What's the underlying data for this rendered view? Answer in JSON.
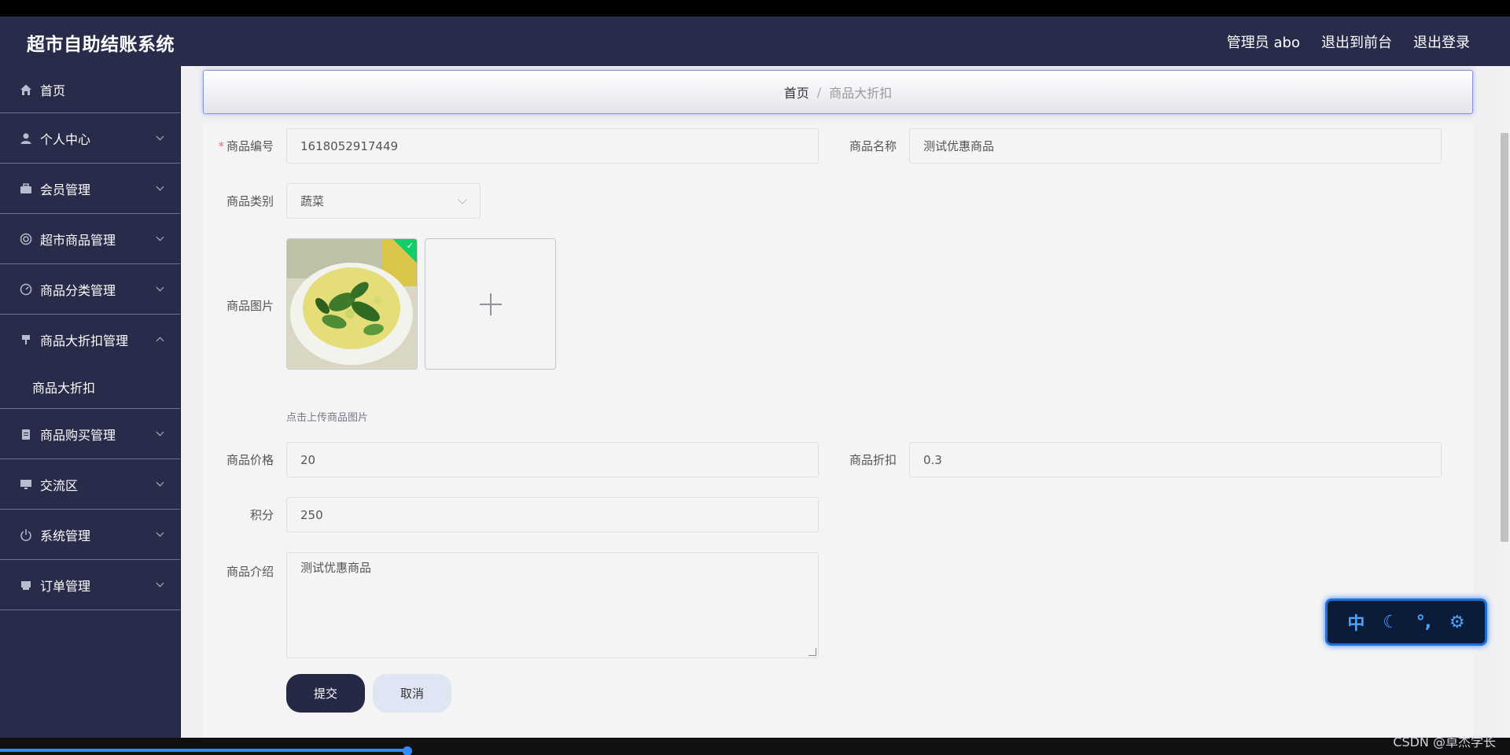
{
  "header": {
    "brand": "超市自助结账系统",
    "admin": "管理员 abo",
    "to_front": "退出到前台",
    "logout": "退出登录"
  },
  "sidebar": {
    "items": [
      {
        "label": "首页",
        "icon": "home-icon"
      },
      {
        "label": "个人中心",
        "icon": "user-icon"
      },
      {
        "label": "会员管理",
        "icon": "briefcase-icon"
      },
      {
        "label": "超市商品管理",
        "icon": "lifebuoy-icon"
      },
      {
        "label": "商品分类管理",
        "icon": "dashboard-icon"
      },
      {
        "label": "商品大折扣管理",
        "icon": "pin-icon"
      },
      {
        "label": "商品购买管理",
        "icon": "clipboard-icon"
      },
      {
        "label": "交流区",
        "icon": "monitor-icon"
      },
      {
        "label": "系统管理",
        "icon": "power-icon"
      },
      {
        "label": "订单管理",
        "icon": "printer-icon"
      }
    ],
    "submenu_active": "商品大折扣"
  },
  "breadcrumb": {
    "home": "首页",
    "separator": "/",
    "current": "商品大折扣"
  },
  "form": {
    "code_label": "商品编号",
    "code_required": "*",
    "code_value": "1618052917449",
    "name_label": "商品名称",
    "name_value": "测试优惠商品",
    "category_label": "商品类别",
    "category_value": "蔬菜",
    "image_label": "商品图片",
    "upload_tip": "点击上传商品图片",
    "price_label": "商品价格",
    "price_value": "20",
    "discount_label": "商品折扣",
    "discount_value": "0.3",
    "points_label": "积分",
    "points_value": "250",
    "intro_label": "商品介绍",
    "intro_value": "测试优惠商品",
    "submit": "提交",
    "cancel": "取消"
  },
  "widget": {
    "lang": "中",
    "moon": "☾",
    "punct": "°,",
    "gear": "⚙"
  },
  "watermark": "CSDN @卓杰学长",
  "colors": {
    "sidebar_bg": "#282b4a",
    "submit_bg": "#262945",
    "accent_blue": "#2f8bff",
    "success": "#13ce66"
  }
}
